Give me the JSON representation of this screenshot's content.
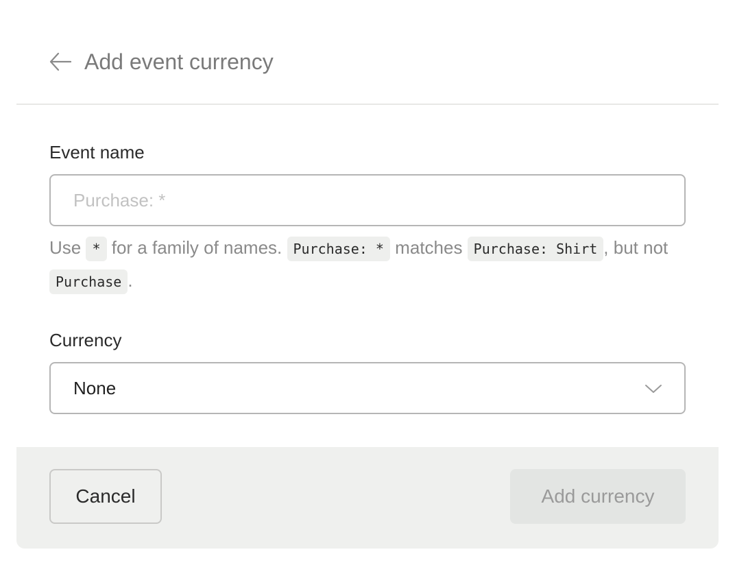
{
  "header": {
    "back_icon": "arrow-left-icon",
    "title": "Add event currency"
  },
  "event_name": {
    "label": "Event name",
    "value": "",
    "placeholder": "Purchase: *"
  },
  "help": {
    "part1": "Use ",
    "code_wildcard": "*",
    "part2": " for a family of names. ",
    "code_example": "Purchase: *",
    "part3": " matches ",
    "code_match": "Purchase: Shirt",
    "part4": ", but not ",
    "code_nonmatch": "Purchase",
    "part5": "."
  },
  "currency": {
    "label": "Currency",
    "selected": "None",
    "dropdown_icon": "chevron-down-icon"
  },
  "footer": {
    "cancel_label": "Cancel",
    "add_label": "Add currency"
  },
  "colors": {
    "title": "#7a7a7a",
    "footer_bg": "#eff0ee",
    "disabled_button_bg": "#e3e5e3",
    "disabled_button_text": "#9a9a9a"
  }
}
